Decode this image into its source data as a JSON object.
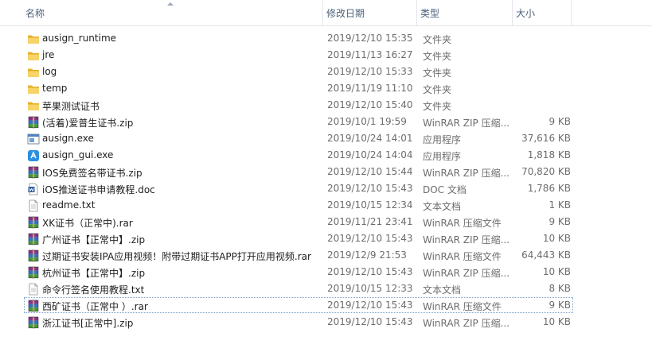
{
  "columns": {
    "name": "名称",
    "date": "修改日期",
    "type": "类型",
    "size": "大小"
  },
  "files": [
    {
      "name": "ausign_runtime",
      "date": "2019/12/10 15:35",
      "type": "文件夹",
      "size": "",
      "icon": "folder-icon"
    },
    {
      "name": "jre",
      "date": "2019/11/13 16:27",
      "type": "文件夹",
      "size": "",
      "icon": "folder-icon"
    },
    {
      "name": "log",
      "date": "2019/12/10 15:33",
      "type": "文件夹",
      "size": "",
      "icon": "folder-icon"
    },
    {
      "name": "temp",
      "date": "2019/11/19 11:10",
      "type": "文件夹",
      "size": "",
      "icon": "folder-icon"
    },
    {
      "name": "苹果测试证书",
      "date": "2019/12/10 15:40",
      "type": "文件夹",
      "size": "",
      "icon": "folder-icon"
    },
    {
      "name": "(活着)爱普生证书.zip",
      "date": "2019/10/1 19:59",
      "type": "WinRAR ZIP 压缩...",
      "size": "9 KB",
      "icon": "winrar-archive-icon"
    },
    {
      "name": "ausign.exe",
      "date": "2019/10/24 14:01",
      "type": "应用程序",
      "size": "37,616 KB",
      "icon": "application-icon"
    },
    {
      "name": "ausign_gui.exe",
      "date": "2019/10/24 14:04",
      "type": "应用程序",
      "size": "1,818 KB",
      "icon": "ausign-app-icon"
    },
    {
      "name": "IOS免费签名带证书.zip",
      "date": "2019/12/10 15:44",
      "type": "WinRAR ZIP 压缩...",
      "size": "70,820 KB",
      "icon": "winrar-archive-icon"
    },
    {
      "name": "iOS推送证书申请教程.doc",
      "date": "2019/12/10 15:43",
      "type": "DOC 文档",
      "size": "1,786 KB",
      "icon": "doc-icon"
    },
    {
      "name": "readme.txt",
      "date": "2019/10/15 12:34",
      "type": "文本文档",
      "size": "1 KB",
      "icon": "text-file-icon"
    },
    {
      "name": "XK证书（正常中).rar",
      "date": "2019/11/21 23:41",
      "type": "WinRAR 压缩文件",
      "size": "9 KB",
      "icon": "winrar-archive-icon"
    },
    {
      "name": "广州证书【正常中】.zip",
      "date": "2019/12/10 15:43",
      "type": "WinRAR ZIP 压缩...",
      "size": "10 KB",
      "icon": "winrar-archive-icon"
    },
    {
      "name": "过期证书安装IPA应用视频！附带过期证书APP打开应用视频.rar",
      "date": "2019/12/9 21:53",
      "type": "WinRAR 压缩文件",
      "size": "64,443 KB",
      "icon": "winrar-archive-icon"
    },
    {
      "name": "杭州证书【正常中】.zip",
      "date": "2019/12/10 15:43",
      "type": "WinRAR ZIP 压缩...",
      "size": "10 KB",
      "icon": "winrar-archive-icon"
    },
    {
      "name": "命令行签名使用教程.txt",
      "date": "2019/10/15 12:33",
      "type": "文本文档",
      "size": "8 KB",
      "icon": "text-file-icon"
    },
    {
      "name": "西矿证书（正常中 ）.rar",
      "date": "2019/12/10 15:43",
      "type": "WinRAR 压缩文件",
      "size": "9 KB",
      "icon": "winrar-archive-icon"
    },
    {
      "name": "浙江证书[正常中].zip",
      "date": "2019/12/10 15:43",
      "type": "WinRAR ZIP 压缩...",
      "size": "10 KB",
      "icon": "winrar-archive-icon"
    }
  ],
  "focused_index": 16
}
